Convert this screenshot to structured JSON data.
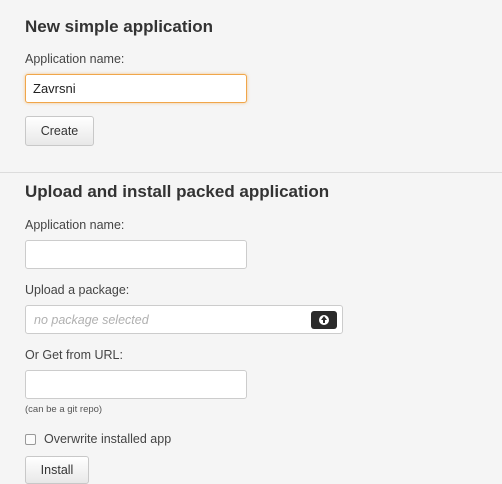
{
  "simple_app": {
    "heading": "New simple application",
    "name_label": "Application name:",
    "name_value": "Zavrsni",
    "create_label": "Create"
  },
  "packed_app": {
    "heading": "Upload and install packed application",
    "name_label": "Application name:",
    "name_value": "",
    "upload_label": "Upload a package:",
    "upload_placeholder": "no package selected",
    "url_label": "Or Get from URL:",
    "url_value": "",
    "url_hint": "(can be a git repo)",
    "overwrite_label": "Overwrite installed app",
    "overwrite_checked": false,
    "install_label": "Install"
  },
  "colors": {
    "focus_border": "#f0a64a",
    "background": "#f5f5f5"
  }
}
